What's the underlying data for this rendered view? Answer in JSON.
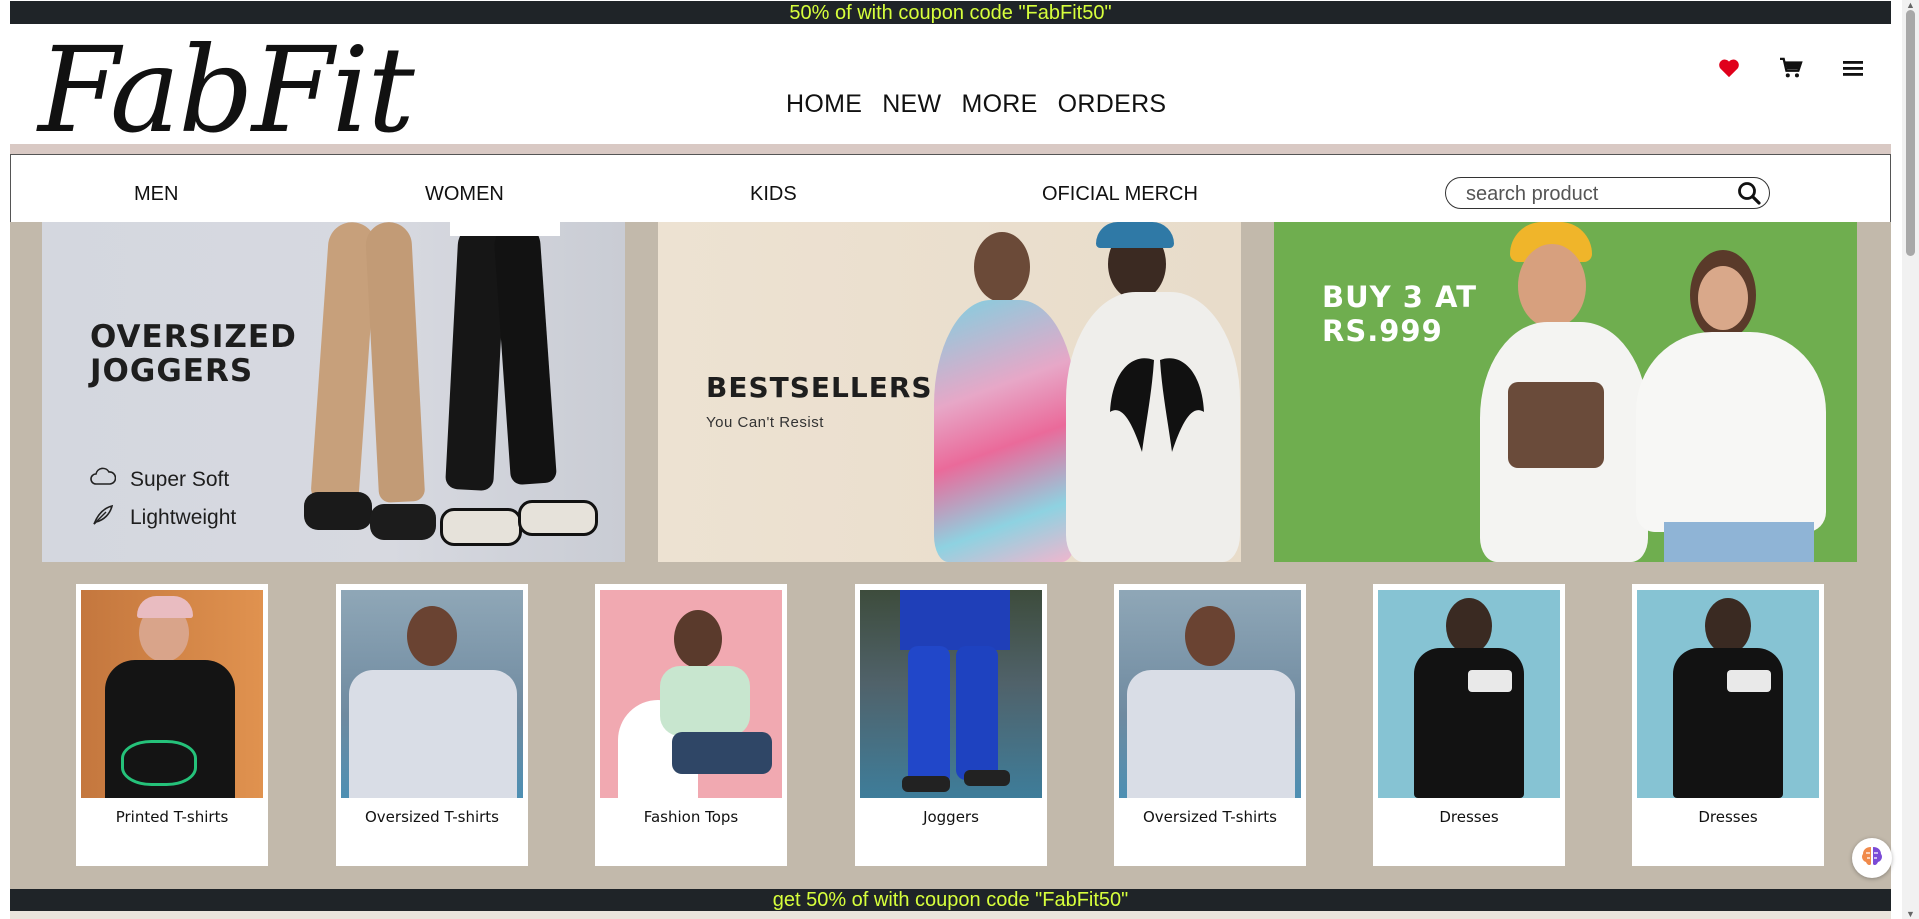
{
  "promo_top": "50% of with coupon code \"FabFit50\"",
  "logo": "FabFit",
  "nav": [
    "HOME",
    "NEW",
    "MORE",
    "ORDERS"
  ],
  "header_icons": [
    "heart-icon",
    "cart-icon",
    "menu-icon"
  ],
  "categories": [
    "MEN",
    "WOMEN",
    "KIDS",
    "OFICIAL MERCH"
  ],
  "search": {
    "placeholder": "search product"
  },
  "banners": [
    {
      "heading": "OVERSIZED\nJOGGERS",
      "features": [
        "Super Soft",
        "Lightweight"
      ]
    },
    {
      "heading": "BESTSELLERS",
      "subheading": "You Can't Resist"
    },
    {
      "heading": "BUY 3 AT\nRS.999"
    }
  ],
  "products": [
    {
      "label": "Printed  T-shirts"
    },
    {
      "label": "Oversized T-shirts"
    },
    {
      "label": "Fashion Tops"
    },
    {
      "label": "Joggers"
    },
    {
      "label": "Oversized T-shirts"
    },
    {
      "label": "Dresses"
    },
    {
      "label": "Dresses"
    }
  ],
  "promo_bottom": "get 50% of with coupon code \"FabFit50\"",
  "colors": {
    "promo_bg": "#1f2428",
    "promo_text": "#d7ff3c",
    "content_bg": "#c2b9ab",
    "heart": "#e0001b"
  }
}
